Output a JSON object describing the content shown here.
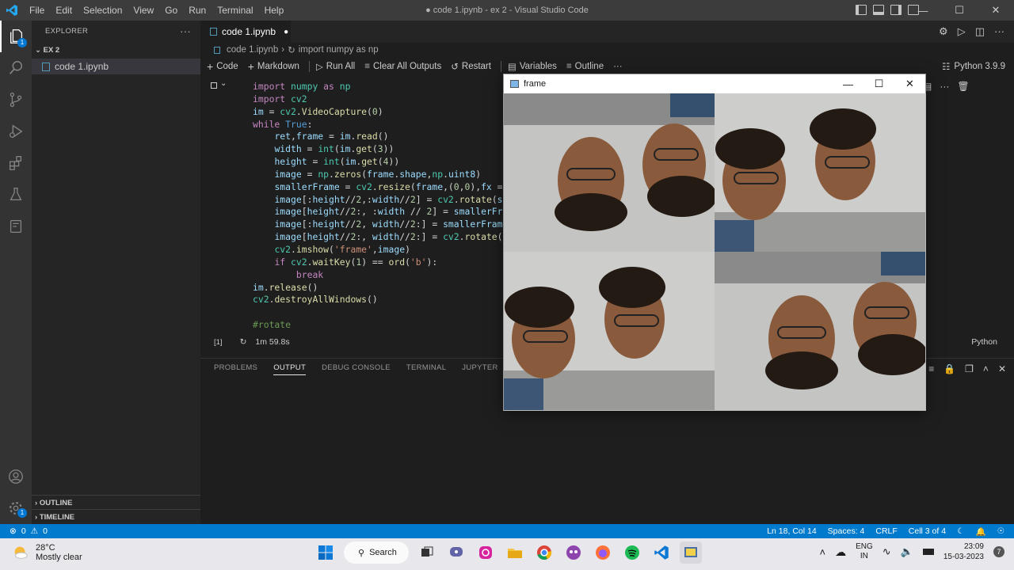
{
  "titlebar": {
    "menu": [
      "File",
      "Edit",
      "Selection",
      "View",
      "Go",
      "Run",
      "Terminal",
      "Help"
    ],
    "window_title": "● code 1.ipynb - ex 2 - Visual Studio Code"
  },
  "sidebar": {
    "header": "EXPLORER",
    "folder": "EX 2",
    "file": "code 1.ipynb",
    "outline": "OUTLINE",
    "timeline": "TIMELINE"
  },
  "editor": {
    "tab_label": "code 1.ipynb",
    "breadcrumb_file": "code 1.ipynb",
    "breadcrumb_cell": "import numpy as np",
    "toolbar": {
      "code": "Code",
      "markdown": "Markdown",
      "run_all": "Run All",
      "clear_outputs": "Clear All Outputs",
      "restart": "Restart",
      "variables": "Variables",
      "outline": "Outline",
      "kernel": "Python 3.9.9"
    },
    "cell": {
      "exec_count": "[1]",
      "duration": "1m 59.8s",
      "language": "Python"
    }
  },
  "panel": {
    "tabs": [
      "PROBLEMS",
      "OUTPUT",
      "DEBUG CONSOLE",
      "TERMINAL",
      "JUPYTER"
    ],
    "active_tab": "OUTPUT"
  },
  "statusbar": {
    "errors": "0",
    "warnings": "0",
    "position": "Ln 18, Col 14",
    "spaces": "Spaces: 4",
    "eol": "CRLF",
    "cell": "Cell 3 of 4"
  },
  "frame_window": {
    "title": "frame"
  },
  "taskbar": {
    "temperature": "28°C",
    "weather": "Mostly clear",
    "search": "Search",
    "lang1": "ENG",
    "lang2": "IN",
    "time": "23:09",
    "date": "15-03-2023",
    "notif": "7"
  },
  "colors": {
    "accent": "#007acc",
    "activity_bg": "#333333",
    "sidebar_bg": "#252526",
    "editor_bg": "#1e1e1e"
  }
}
